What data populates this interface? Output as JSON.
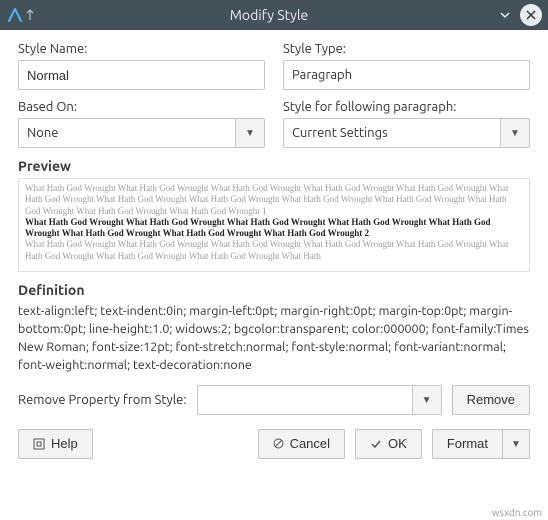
{
  "window": {
    "title": "Modify Style"
  },
  "fields": {
    "style_name_label": "Style Name:",
    "style_name_value": "Normal",
    "style_type_label": "Style Type:",
    "style_type_value": "Paragraph",
    "based_on_label": "Based On:",
    "based_on_value": "None",
    "following_label": "Style for following paragraph:",
    "following_value": "Current Settings"
  },
  "preview": {
    "heading": "Preview",
    "sample_gray_1": "What Hath God Wrought  What Hath God Wrought  What Hath God Wrought  What Hath God Wrought  What Hath God Wrought  What Hath God Wrought  What Hath God Wrought  What Hath God Wrought  What Hath God Wrought  What Hath God Wrought  What Hath God Wrought  What Hath God Wrought  What Hath God Wrought  1",
    "sample_bold": "What Hath God Wrought  What Hath God Wrought  What Hath God Wrought  What Hath God Wrought  What Hath God Wrought  What Hath God Wrought  What Hath God Wrought  What Hath God Wrought  2",
    "sample_gray_2": "What Hath God Wrought  What Hath God Wrought  What Hath God Wrought  What Hath God Wrought  What Hath God Wrought  What Hath God Wrought  What Hath God Wrought  What Hath God Wrought  What Hath"
  },
  "definition": {
    "heading": "Definition",
    "text": "text-align:left; text-indent:0in; margin-left:0pt; margin-right:0pt; margin-top:0pt; margin-bottom:0pt; line-height:1.0; widows:2; bgcolor:transparent; color:000000; font-family:Times New Roman; font-size:12pt; font-stretch:normal; font-style:normal; font-variant:normal; font-weight:normal; text-decoration:none"
  },
  "remove": {
    "label": "Remove Property from Style:",
    "value": "",
    "button": "Remove"
  },
  "buttons": {
    "help": "Help",
    "cancel": "Cancel",
    "ok": "OK",
    "format": "Format"
  },
  "watermark": "wsxdn.com"
}
